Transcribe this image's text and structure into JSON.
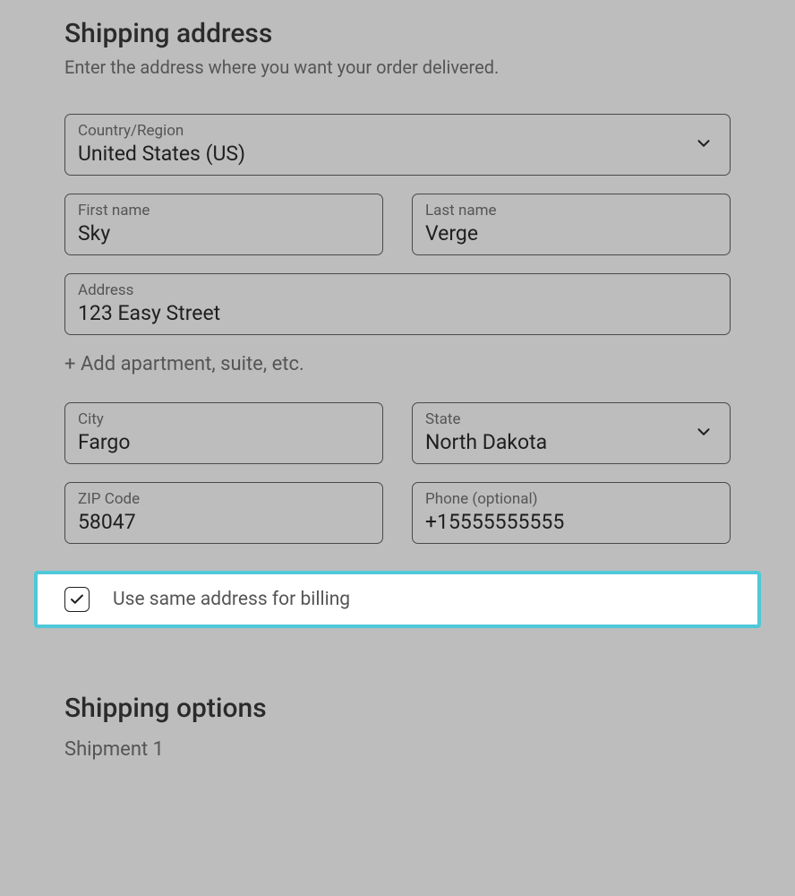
{
  "shipping": {
    "title": "Shipping address",
    "subtitle": "Enter the address where you want your order delivered.",
    "country": {
      "label": "Country/Region",
      "value": "United States (US)"
    },
    "first_name": {
      "label": "First name",
      "value": "Sky"
    },
    "last_name": {
      "label": "Last name",
      "value": "Verge"
    },
    "address": {
      "label": "Address",
      "value": "123 Easy Street"
    },
    "add_line": "+ Add apartment, suite, etc.",
    "city": {
      "label": "City",
      "value": "Fargo"
    },
    "state": {
      "label": "State",
      "value": "North Dakota"
    },
    "zip": {
      "label": "ZIP Code",
      "value": "58047"
    },
    "phone": {
      "label": "Phone (optional)",
      "value": "+15555555555"
    },
    "same_billing": {
      "label": "Use same address for billing",
      "checked": true
    }
  },
  "shipping_options": {
    "title": "Shipping options",
    "shipment_label": "Shipment 1"
  }
}
